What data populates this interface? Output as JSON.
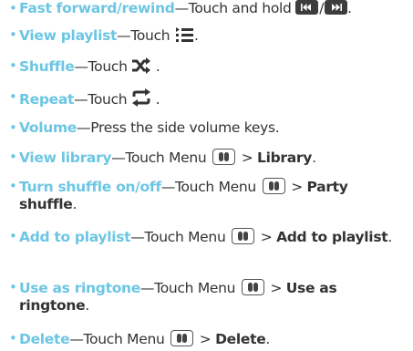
{
  "items": [
    {
      "term": "Fast forward/rewind",
      "text": "—Touch and hold ",
      "sep": "/",
      "end": "."
    },
    {
      "term": "View playlist",
      "text": "—Touch ",
      "end": "."
    },
    {
      "term": "Shuffle",
      "text": "—Touch ",
      "end": " ."
    },
    {
      "term": "Repeat",
      "text": "—Touch ",
      "end": " ."
    },
    {
      "term": "Volume",
      "text": "—Press the side volume keys."
    },
    {
      "term": "View library",
      "text": "—Touch Menu ",
      "gt": " > ",
      "target": "Library",
      "end": "."
    },
    {
      "term": "Turn shuffle on/off",
      "text": "—Touch Menu ",
      "gt": " > ",
      "target": "Party shuffle",
      "end": "."
    },
    {
      "term": "Add to playlist",
      "text": "—Touch Menu ",
      "gt": " > ",
      "target": "Add to playlist",
      "end": "."
    },
    {
      "term": "Use as ringtone",
      "text": "—Touch Menu ",
      "gt": " > ",
      "target": "Use as ringtone",
      "end": "."
    },
    {
      "term": "Delete",
      "text": "—Touch Menu ",
      "gt": " > ",
      "target": "Delete",
      "end": "."
    }
  ],
  "bullet": "•",
  "colors": {
    "term": "#6cc6e3",
    "text": "#333333",
    "icon": "#3d3d3d"
  },
  "icons": {
    "rewind": "rewind-icon",
    "fast_forward": "fast-forward-icon",
    "playlist": "playlist-icon",
    "shuffle": "shuffle-icon",
    "repeat": "repeat-icon",
    "menu": "menu-key-icon"
  }
}
